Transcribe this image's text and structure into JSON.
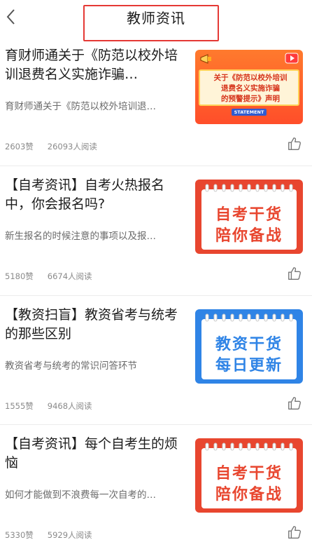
{
  "header": {
    "title": "教师资讯"
  },
  "articles": [
    {
      "title": "育财师通关于《防范以校外培训退费名义实施诈骗…",
      "desc": "育财师通关于《防范以校外培训退…",
      "likes": "2603赞",
      "reads": "26093人阅读",
      "thumb": {
        "style": "promo",
        "lines": [
          "关于《防范以校外培训",
          "退费名义实施诈骗",
          "的预警提示》声明"
        ],
        "tag": "STATEMENT"
      }
    },
    {
      "title": "【自考资讯】自考火热报名中，你会报名吗?",
      "desc": "新生报名的时候注意的事项以及报…",
      "likes": "5180赞",
      "reads": "6674人阅读",
      "thumb": {
        "style": "red",
        "lines": [
          "自考干货",
          "陪你备战"
        ]
      }
    },
    {
      "title": "【教资扫盲】教资省考与统考的那些区别",
      "desc": "教资省考与统考的常识问答环节",
      "likes": "1555赞",
      "reads": "9468人阅读",
      "thumb": {
        "style": "blue",
        "lines": [
          "教资干货",
          "每日更新"
        ]
      }
    },
    {
      "title": "【自考资讯】每个自考生的烦恼",
      "desc": "如何才能做到不浪费每一次自考的…",
      "likes": "5330赞",
      "reads": "5929人阅读",
      "thumb": {
        "style": "red",
        "lines": [
          "自考干货",
          "陪你备战"
        ]
      }
    }
  ],
  "colors": {
    "highlight_box": "#e53935",
    "thumb_red": "#e8462f",
    "thumb_blue": "#2f84e6",
    "thumb_promo": "#ff5a2a"
  },
  "icons": {
    "back": "chevron-left-icon",
    "like": "thumbs-up-icon"
  }
}
